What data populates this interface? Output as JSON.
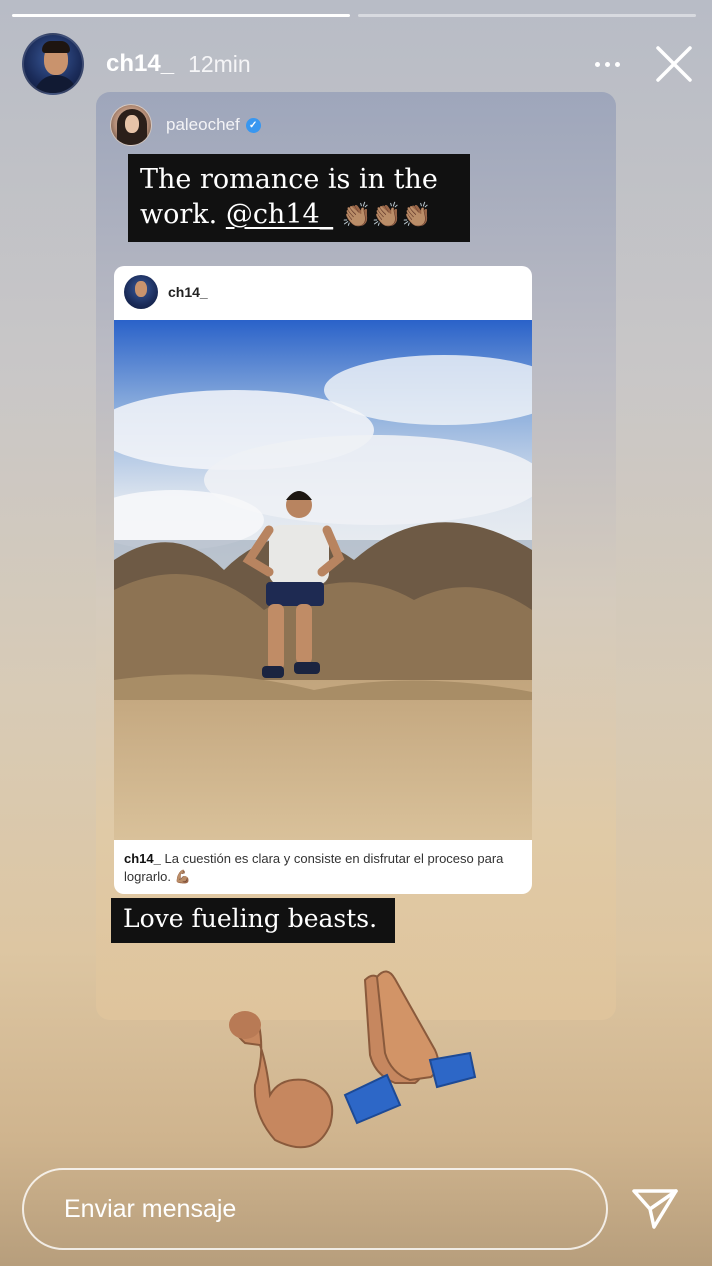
{
  "progress": [
    1.0,
    0.0
  ],
  "header": {
    "username": "ch14_",
    "time": "12min"
  },
  "shared_story": {
    "author": "paleochef",
    "verified": true,
    "quote": {
      "line1": "The romance is in the",
      "line2_prefix": "work.",
      "mention": "@ch14_",
      "emoji": "👏🏽👏🏽👏🏽"
    },
    "post": {
      "username": "ch14_",
      "caption_user": "ch14_",
      "caption_text": "La cuestión es clara y consiste en disfrutar el proceso para lograrlo. 💪🏽"
    },
    "footer_text": "Love fueling beasts."
  },
  "message": {
    "placeholder": "Enviar mensaje"
  }
}
